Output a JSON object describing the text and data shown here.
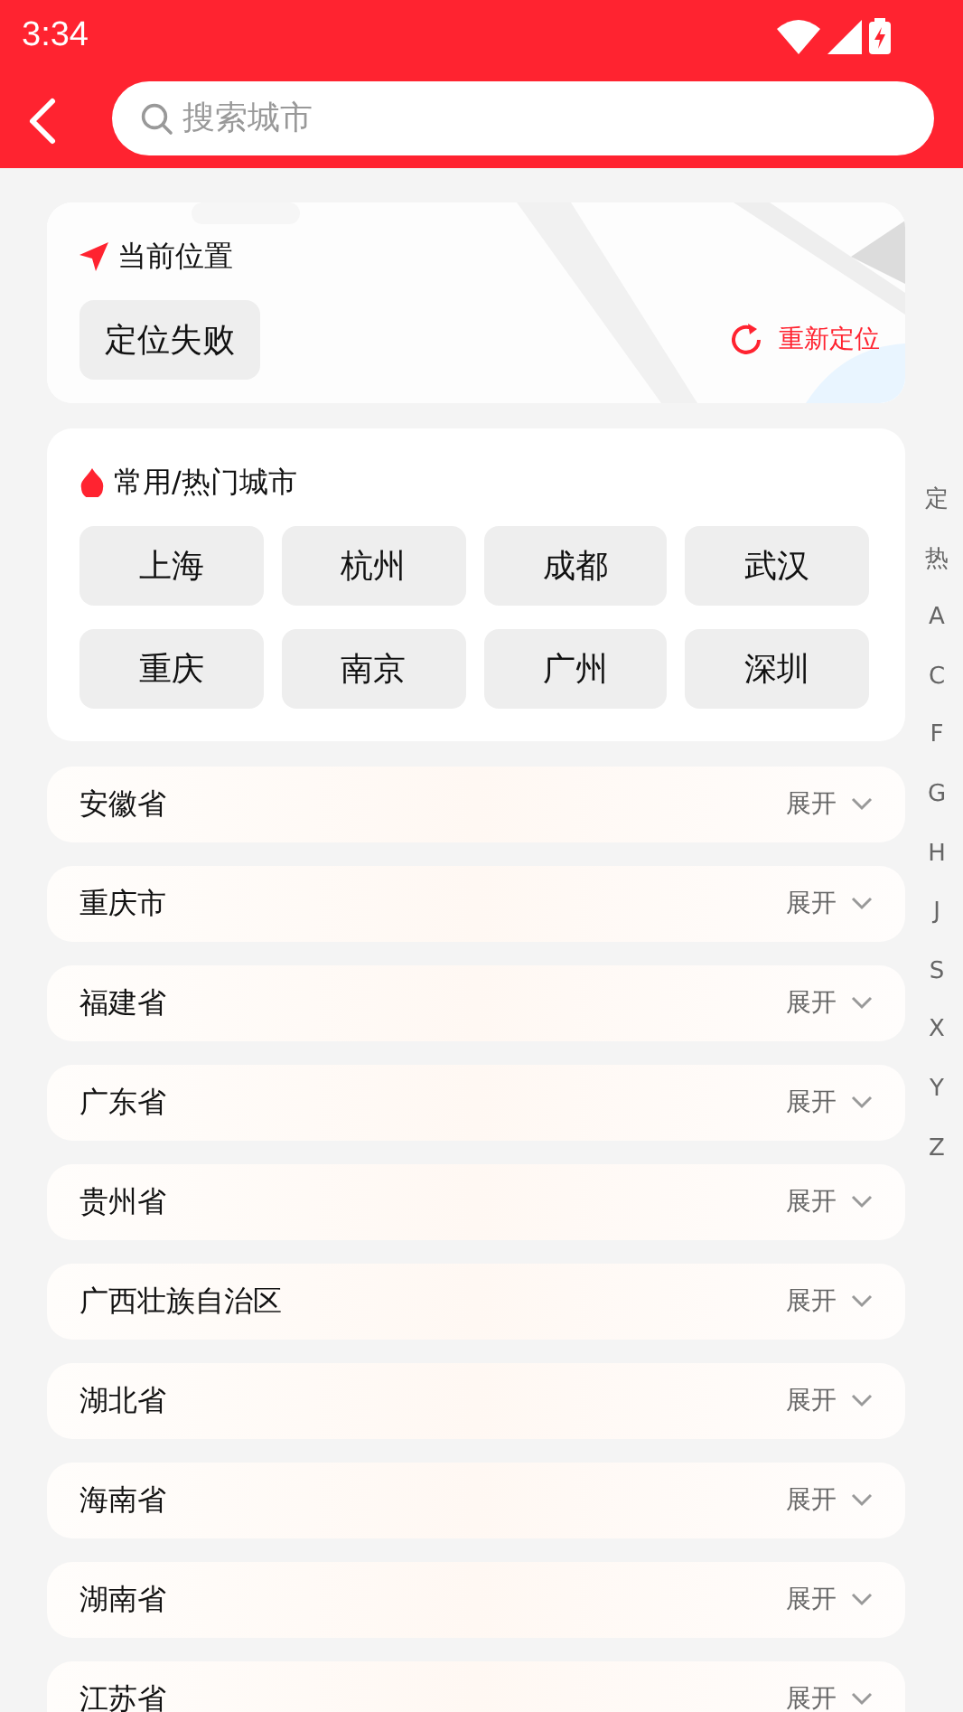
{
  "status_bar": {
    "time": "3:34"
  },
  "search": {
    "placeholder": "搜索城市"
  },
  "current_location": {
    "title": "当前位置",
    "status": "定位失败",
    "relocate": "重新定位"
  },
  "hot_cities": {
    "title": "常用/热门城市",
    "cities": [
      "上海",
      "杭州",
      "成都",
      "武汉",
      "重庆",
      "南京",
      "广州",
      "深圳"
    ]
  },
  "provinces": [
    {
      "name": "安徽省",
      "toggle": "展开",
      "expanded": false
    },
    {
      "name": "重庆市",
      "toggle": "展开",
      "expanded": false
    },
    {
      "name": "福建省",
      "toggle": "展开",
      "expanded": false
    },
    {
      "name": "广东省",
      "toggle": "展开",
      "expanded": false
    },
    {
      "name": "贵州省",
      "toggle": "展开",
      "expanded": false
    },
    {
      "name": "广西壮族自治区",
      "toggle": "展开",
      "expanded": false
    },
    {
      "name": "湖北省",
      "toggle": "展开",
      "expanded": false
    },
    {
      "name": "海南省",
      "toggle": "展开",
      "expanded": false
    },
    {
      "name": "湖南省",
      "toggle": "展开",
      "expanded": false
    },
    {
      "name": "江苏省",
      "toggle": "展开",
      "expanded": false
    }
  ],
  "index_bar": [
    "定",
    "热",
    "A",
    "C",
    "F",
    "G",
    "H",
    "J",
    "S",
    "X",
    "Y",
    "Z"
  ]
}
